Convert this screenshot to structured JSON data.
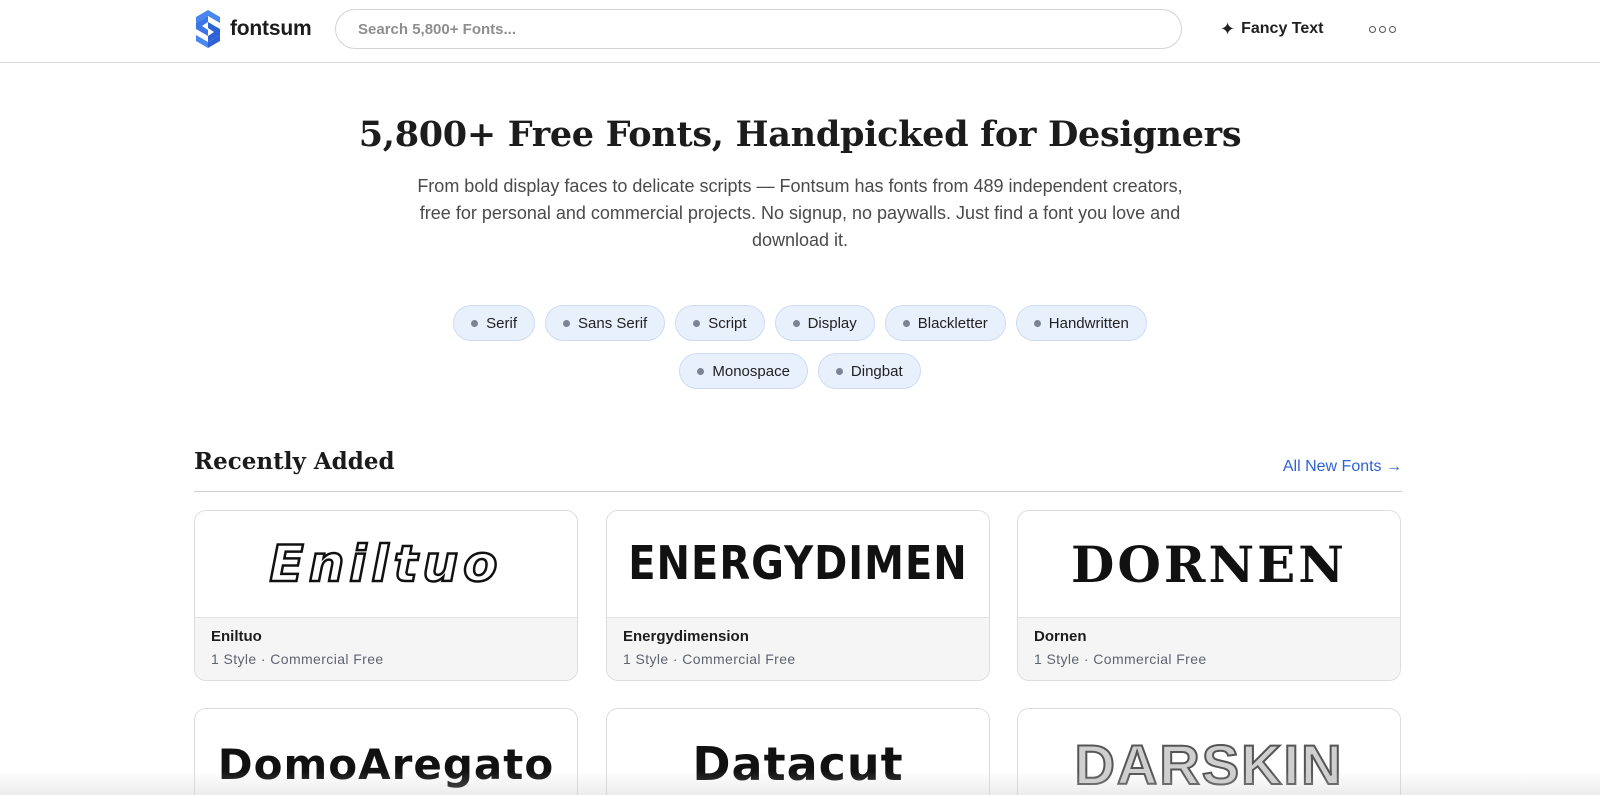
{
  "header": {
    "logo_text": "fontsum",
    "search_placeholder": "Search 5,800+ Fonts...",
    "fancy_text_label": "Fancy Text",
    "fancy_text_icon": "sparkle-icon",
    "more_icon": "more-dots-icon"
  },
  "hero": {
    "title": "5,800+ Free Fonts, Handpicked for Designers",
    "subtitle": "From bold display faces to delicate scripts — Fontsum has fonts from 489 independent creators, free for personal and commercial projects. No signup, no paywalls. Just find a font you love and download it."
  },
  "categories": [
    "Serif",
    "Sans Serif",
    "Script",
    "Display",
    "Blackletter",
    "Handwritten",
    "Monospace",
    "Dingbat"
  ],
  "recent": {
    "title": "Recently Added",
    "link_label": "All New Fonts →",
    "fonts": [
      {
        "name": "Eniltuo",
        "meta": "1 Style · Commercial Free",
        "preview": "Eniltuo"
      },
      {
        "name": "Energydimension",
        "meta": "1 Style · Commercial Free",
        "preview": "ENERGYDIMEN"
      },
      {
        "name": "Dornen",
        "meta": "1 Style · Commercial Free",
        "preview": "DORNEN"
      },
      {
        "name": "DomoAregato",
        "meta": "",
        "preview": "DomoAregato"
      },
      {
        "name": "Datacut",
        "meta": "",
        "preview": "Datacut"
      },
      {
        "name": "Darskin",
        "meta": "",
        "preview": "DARSKIN"
      }
    ]
  },
  "colors": {
    "accent": "#2f63d3",
    "logo_blue": "#3b76e8",
    "pill_bg": "#e8f0fc"
  }
}
